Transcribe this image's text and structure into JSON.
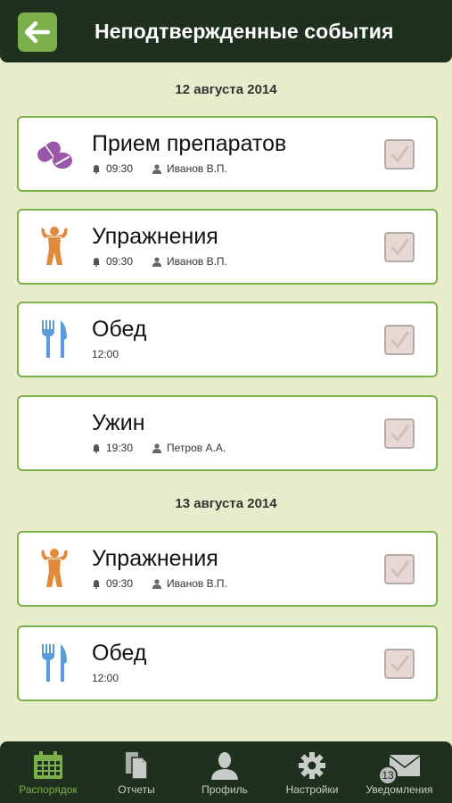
{
  "header": {
    "title": "Неподтвержденные события",
    "back_icon": "arrow-left-icon"
  },
  "days": [
    {
      "date": "12 августа 2014",
      "events": [
        {
          "title": "Прием препаратов",
          "icon": "pills-icon",
          "time": "09:30",
          "person": "Иванов В.П."
        },
        {
          "title": "Упражнения",
          "icon": "bodybuilder-icon",
          "time": "09:30",
          "person": "Иванов В.П."
        },
        {
          "title": "Обед",
          "icon": "fork-knife-icon",
          "time": "12:00"
        },
        {
          "title": "Ужин",
          "time": "19:30",
          "person": "Петров А.А."
        }
      ]
    },
    {
      "date": "13 августа 2014",
      "events": [
        {
          "title": "Упражнения",
          "icon": "bodybuilder-icon",
          "time": "09:30",
          "person": "Иванов В.П."
        },
        {
          "title": "Обед",
          "icon": "fork-knife-icon",
          "time": "12:00"
        }
      ]
    }
  ],
  "tabs": [
    {
      "label": "Распорядок",
      "icon": "calendar-icon",
      "active": true
    },
    {
      "label": "Отчеты",
      "icon": "documents-icon"
    },
    {
      "label": "Профиль",
      "icon": "user-icon"
    },
    {
      "label": "Настройки",
      "icon": "gear-icon"
    },
    {
      "label": "Уведомления",
      "icon": "envelope-icon",
      "badge": "13"
    }
  ],
  "colors": {
    "accent": "#7cb04a",
    "bar": "#20301f",
    "background": "#e8ecca",
    "pills": "#9a56a8",
    "exercise": "#e08a3c",
    "food": "#5b9bd8"
  }
}
